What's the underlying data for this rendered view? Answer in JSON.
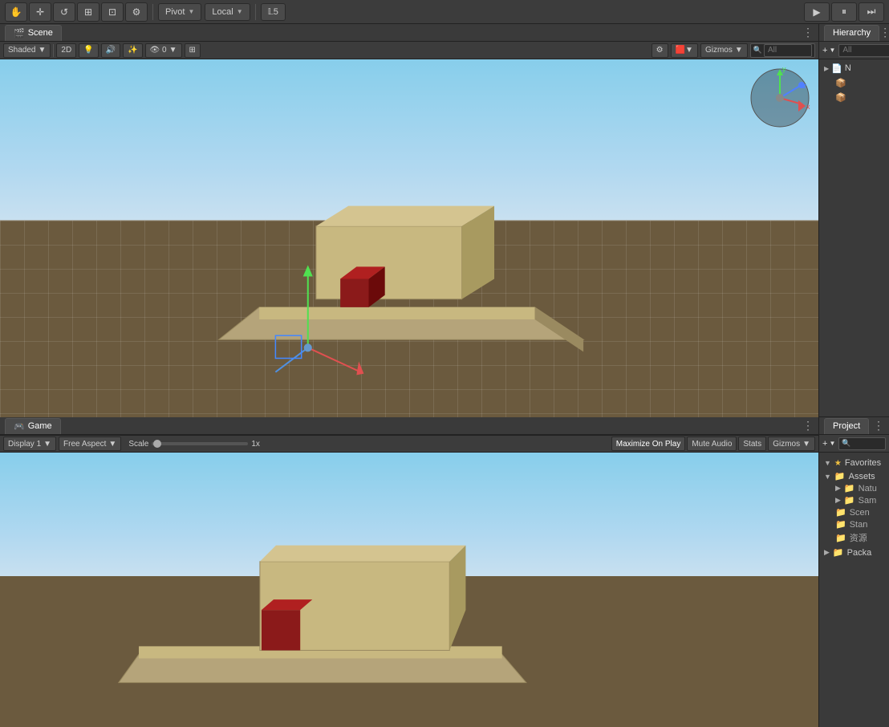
{
  "toolbar": {
    "tools": [
      {
        "label": "✋",
        "name": "hand-tool",
        "active": false
      },
      {
        "label": "✛",
        "name": "move-tool",
        "active": false
      },
      {
        "label": "↺",
        "name": "rotate-tool",
        "active": false
      },
      {
        "label": "⊞",
        "name": "scale-tool",
        "active": false
      },
      {
        "label": "⊡",
        "name": "rect-tool",
        "active": false
      },
      {
        "label": "⚙",
        "name": "transform-tool",
        "active": false
      }
    ],
    "pivot_label": "Pivot",
    "local_label": "Local",
    "layers_label": "𝕃5",
    "play_label": "▶",
    "pause_label": "⏸",
    "step_label": "⏭"
  },
  "scene_panel": {
    "tab_label": "Scene",
    "tab_icon": "🎬",
    "shading": "Shaded",
    "two_d": "2D",
    "gizmos_label": "Gizmos",
    "search_placeholder": "All"
  },
  "game_panel": {
    "tab_label": "Game",
    "tab_icon": "🎮",
    "display": "Display 1",
    "aspect": "Free Aspect",
    "scale_label": "Scale",
    "scale_value": "1x",
    "maximize": "Maximize On Play",
    "mute": "Mute Audio",
    "stats": "Stats",
    "gizmos": "Gizmos"
  },
  "hierarchy_panel": {
    "tab_label": "Hierarchy",
    "add_icon": "+",
    "search_placeholder": "All",
    "items": [
      {
        "label": "N",
        "indent": 0,
        "icon": "📄",
        "selected": false
      },
      {
        "label": "",
        "indent": 1,
        "icon": "📦",
        "selected": false
      },
      {
        "label": "",
        "indent": 1,
        "icon": "📦",
        "selected": false
      }
    ]
  },
  "project_panel": {
    "tab_label": "Project",
    "add_icon": "+",
    "search_placeholder": "",
    "favorites_label": "Favorites",
    "assets_label": "Assets",
    "folders": [
      {
        "label": "Natu",
        "indent": 1
      },
      {
        "label": "Sam",
        "indent": 1
      },
      {
        "label": "Scen",
        "indent": 1
      },
      {
        "label": "Stan",
        "indent": 1
      },
      {
        "label": "资源",
        "indent": 1
      }
    ],
    "packages_label": "Packa"
  },
  "colors": {
    "sky_top": "#87CEEB",
    "sky_bottom": "#c8e0f0",
    "ground": "#6b5a3e",
    "grid_line": "rgba(255,255,255,0.1)",
    "box_color": "#b8a87a",
    "red_cube": "#8B1A1A",
    "axis_x": "#e05050",
    "axis_y": "#50e050",
    "axis_z": "#5050e0",
    "accent_blue": "#2b5a9e"
  }
}
